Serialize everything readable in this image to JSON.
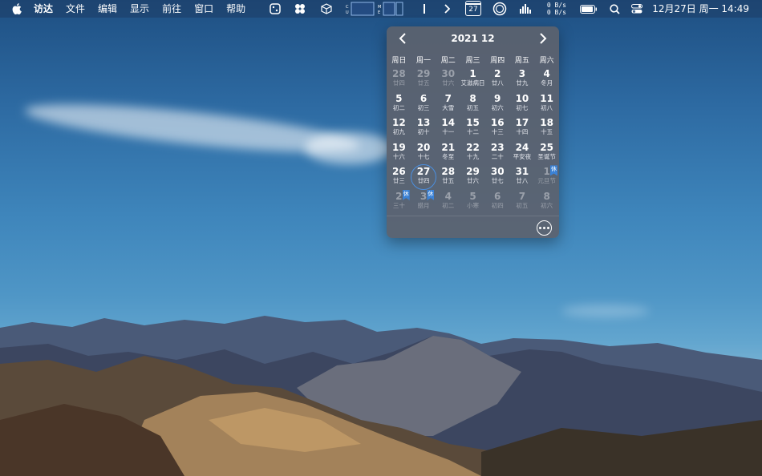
{
  "menubar": {
    "app_name": "访达",
    "menus": [
      "文件",
      "编辑",
      "显示",
      "前往",
      "窗口",
      "帮助"
    ],
    "calendar_icon_day": "27",
    "net_up": "0 B/s",
    "net_down": "0 B/s",
    "clock": "12月27日 周一  14:49",
    "icons": [
      "apple-icon",
      "dice-icon",
      "clover-icon",
      "cube-icon",
      "cpu-graph-icon",
      "memory-graph-icon",
      "text-cursor-icon",
      "chevron-right-icon",
      "calendar-icon",
      "circle-icon",
      "signal-icon",
      "battery-icon",
      "search-icon",
      "control-center-icon"
    ]
  },
  "calendar": {
    "title": "2021 12",
    "weekdays": [
      "周日",
      "周一",
      "周二",
      "周三",
      "周四",
      "周五",
      "周六"
    ],
    "accent_color": "#4b8fe0",
    "badge_color": "#3b82d6",
    "badge_label": "休",
    "days": [
      {
        "n": "28",
        "l": "廿四",
        "other": true
      },
      {
        "n": "29",
        "l": "廿五",
        "other": true
      },
      {
        "n": "30",
        "l": "廿六",
        "other": true
      },
      {
        "n": "1",
        "l": "艾滋病日"
      },
      {
        "n": "2",
        "l": "廿八"
      },
      {
        "n": "3",
        "l": "廿九"
      },
      {
        "n": "4",
        "l": "冬月"
      },
      {
        "n": "5",
        "l": "初二"
      },
      {
        "n": "6",
        "l": "初三"
      },
      {
        "n": "7",
        "l": "大雪"
      },
      {
        "n": "8",
        "l": "初五"
      },
      {
        "n": "9",
        "l": "初六"
      },
      {
        "n": "10",
        "l": "初七"
      },
      {
        "n": "11",
        "l": "初八"
      },
      {
        "n": "12",
        "l": "初九"
      },
      {
        "n": "13",
        "l": "初十"
      },
      {
        "n": "14",
        "l": "十一"
      },
      {
        "n": "15",
        "l": "十二"
      },
      {
        "n": "16",
        "l": "十三"
      },
      {
        "n": "17",
        "l": "十四"
      },
      {
        "n": "18",
        "l": "十五"
      },
      {
        "n": "19",
        "l": "十六"
      },
      {
        "n": "20",
        "l": "十七"
      },
      {
        "n": "21",
        "l": "冬至"
      },
      {
        "n": "22",
        "l": "十九"
      },
      {
        "n": "23",
        "l": "二十"
      },
      {
        "n": "24",
        "l": "平安夜"
      },
      {
        "n": "25",
        "l": "圣诞节"
      },
      {
        "n": "26",
        "l": "廿三"
      },
      {
        "n": "27",
        "l": "廿四",
        "today": true
      },
      {
        "n": "28",
        "l": "廿五"
      },
      {
        "n": "29",
        "l": "廿六"
      },
      {
        "n": "30",
        "l": "廿七"
      },
      {
        "n": "31",
        "l": "廿八"
      },
      {
        "n": "1",
        "l": "元旦节",
        "other": true,
        "holiday": true
      },
      {
        "n": "2",
        "l": "三十",
        "other": true,
        "holiday": true
      },
      {
        "n": "3",
        "l": "腊月",
        "other": true,
        "holiday": true
      },
      {
        "n": "4",
        "l": "初二",
        "other": true
      },
      {
        "n": "5",
        "l": "小寒",
        "other": true
      },
      {
        "n": "6",
        "l": "初四",
        "other": true
      },
      {
        "n": "7",
        "l": "初五",
        "other": true
      },
      {
        "n": "8",
        "l": "初六",
        "other": true
      }
    ],
    "footer_icon": "more-icon"
  }
}
